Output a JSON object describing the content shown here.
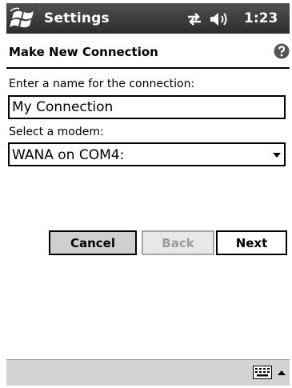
{
  "title_bar": {
    "app_title": "Settings",
    "time": "1:23",
    "icons": [
      "windows-start-icon",
      "connectivity-icon",
      "volume-icon"
    ]
  },
  "header": {
    "title": "Make New Connection",
    "help_icon": "help-icon"
  },
  "form": {
    "name_label": "Enter a name for the connection:",
    "name_value": "My Connection",
    "modem_label": "Select a modem:",
    "modem_value": "WANA on COM4:"
  },
  "buttons": {
    "cancel": "Cancel",
    "back": "Back",
    "next": "Next"
  },
  "menu_bar": {
    "icons": [
      "keyboard-icon",
      "input-panel-arrow-icon"
    ]
  },
  "colors": {
    "title_bar": "#3d3d3d",
    "menu_bar": "#d3d3d3",
    "button_face": "#cfcfcf",
    "disabled_text": "#9a9a9a"
  }
}
